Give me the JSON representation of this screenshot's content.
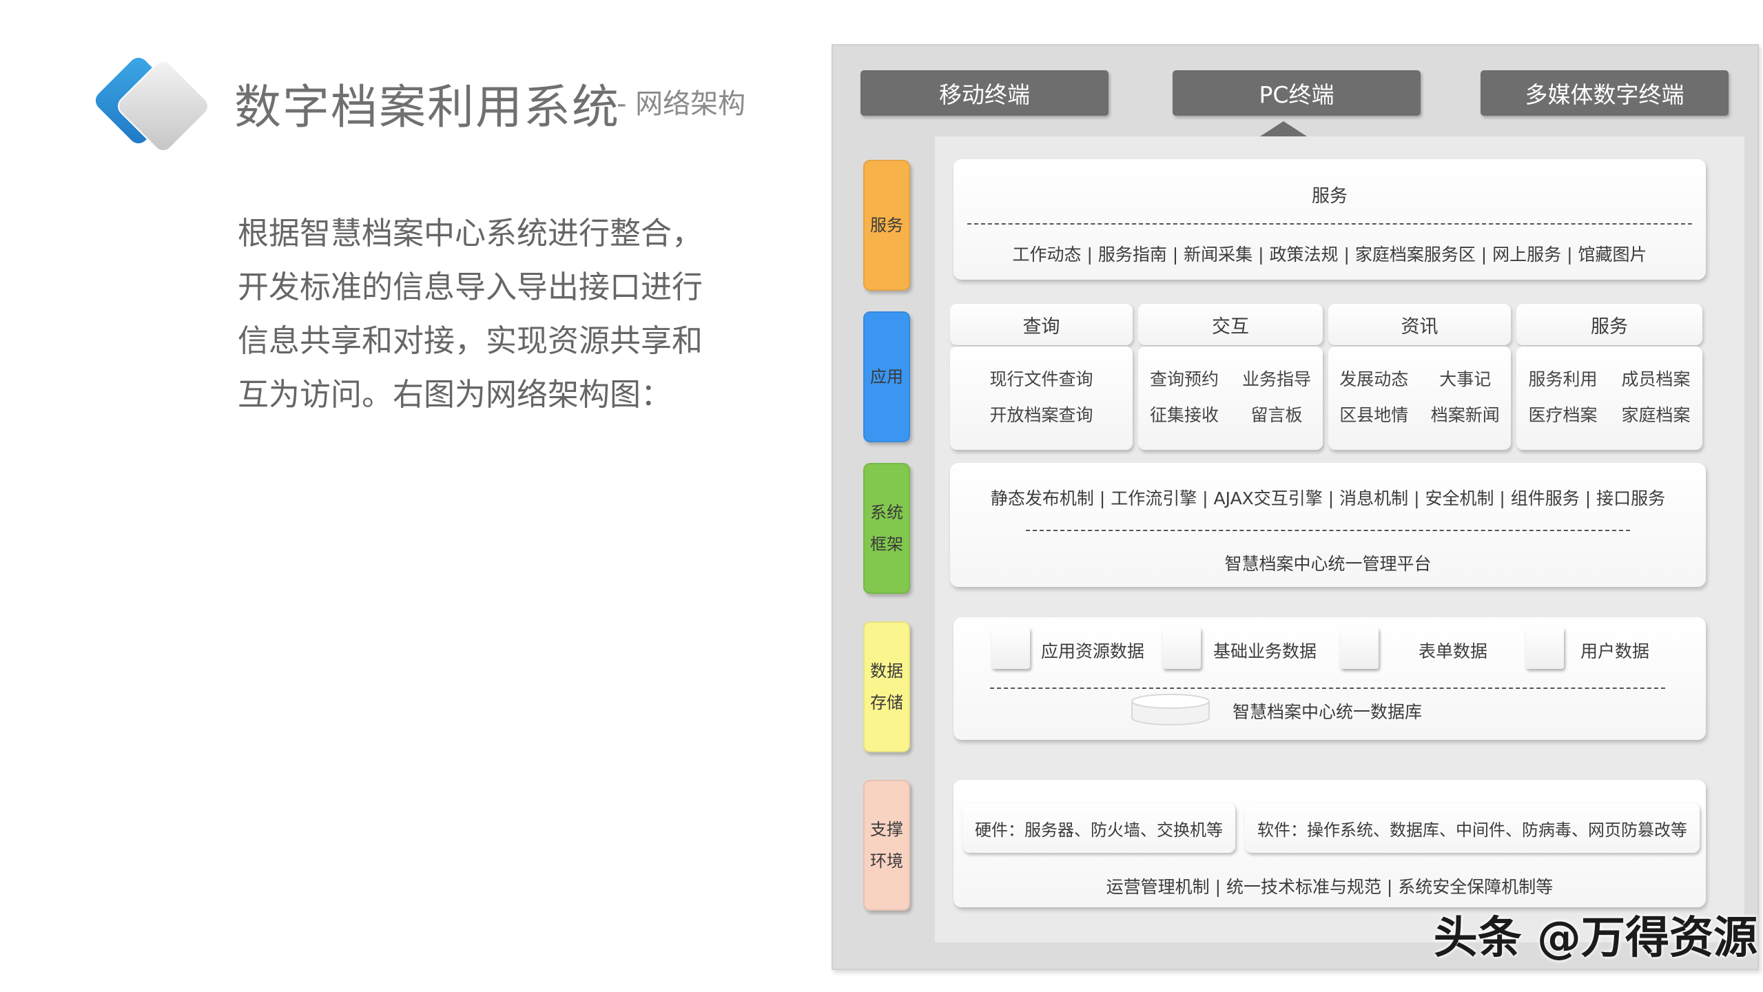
{
  "header": {
    "title": "数字档案利用系统",
    "subtitle": "- 网络架构"
  },
  "description": {
    "lines": [
      "根据智慧档案中心系统进行整合，",
      "开发标准的信息导入导出接口进行",
      "信息共享和对接，实现资源共享和",
      "互为访问。右图为网络架构图："
    ]
  },
  "diagram": {
    "terminals": [
      "移动终端",
      "PC终端",
      "多媒体数字终端"
    ],
    "layers": [
      {
        "label": "服务",
        "color": "#f8b24a"
      },
      {
        "label": "应用",
        "color": "#3a96f0"
      },
      {
        "label": "系统框架",
        "color": "#82c84e"
      },
      {
        "label": "数据存储",
        "color": "#fbf58e"
      },
      {
        "label": "支撑环境",
        "color": "#f8d3c2"
      }
    ],
    "service": {
      "title": "服务",
      "items": "工作动态 | 服务指南 | 新闻采集 | 政策法规 | 家庭档案服务区 | 网上服务 | 馆藏图片"
    },
    "application": {
      "columns": [
        {
          "head": "查询",
          "items": [
            "现行文件查询",
            "开放档案查询"
          ]
        },
        {
          "head": "交互",
          "items": [
            "查询预约",
            "业务指导",
            "征集接收",
            "留言板"
          ]
        },
        {
          "head": "资讯",
          "items": [
            "发展动态",
            "大事记",
            "区县地情",
            "档案新闻"
          ]
        },
        {
          "head": "服务",
          "items": [
            "服务利用",
            "成员档案",
            "医疗档案",
            "家庭档案"
          ]
        }
      ]
    },
    "framework": {
      "items": "静态发布机制 | 工作流引擎 | AJAX交互引擎 | 消息机制 | 安全机制 | 组件服务 | 接口服务",
      "platform": "智慧档案中心统一管理平台"
    },
    "storage": {
      "items": [
        "应用资源数据",
        "基础业务数据",
        "表单数据",
        "用户数据"
      ],
      "database": "智慧档案中心统一数据库"
    },
    "support": {
      "hardware": "硬件：服务器、防火墙、交换机等",
      "software": "软件：操作系统、数据库、中间件、防病毒、网页防篡改等",
      "management": "运营管理机制 | 统一技术标准与规范 | 系统安全保障机制等"
    }
  },
  "watermark": "头条 @万得资源"
}
